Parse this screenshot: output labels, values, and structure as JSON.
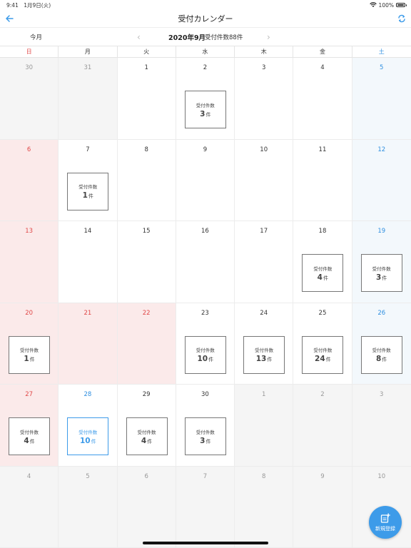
{
  "status_bar": {
    "time": "9:41",
    "date": "1月9日(火)",
    "battery": "100%",
    "battery_level": 1.0
  },
  "nav": {
    "title": "受付カレンダー"
  },
  "month_bar": {
    "today_label": "今月",
    "month": "2020年9月",
    "count_text": "受付件数88件"
  },
  "weekdays": [
    "日",
    "月",
    "火",
    "水",
    "木",
    "金",
    "土"
  ],
  "box_label": "受付件数",
  "unit": "件",
  "weeks": [
    [
      {
        "day": "30",
        "kind": "outside"
      },
      {
        "day": "31",
        "kind": "outside"
      },
      {
        "day": "1"
      },
      {
        "day": "2",
        "count": "3"
      },
      {
        "day": "3"
      },
      {
        "day": "4"
      },
      {
        "day": "5",
        "kind": "saturday"
      }
    ],
    [
      {
        "day": "6",
        "kind": "holiday"
      },
      {
        "day": "7",
        "count": "1"
      },
      {
        "day": "8"
      },
      {
        "day": "9"
      },
      {
        "day": "10"
      },
      {
        "day": "11"
      },
      {
        "day": "12",
        "kind": "saturday"
      }
    ],
    [
      {
        "day": "13",
        "kind": "holiday"
      },
      {
        "day": "14"
      },
      {
        "day": "15"
      },
      {
        "day": "16"
      },
      {
        "day": "17"
      },
      {
        "day": "18",
        "count": "4"
      },
      {
        "day": "19",
        "kind": "saturday",
        "count": "3"
      }
    ],
    [
      {
        "day": "20",
        "kind": "holiday",
        "count": "1"
      },
      {
        "day": "21",
        "kind": "holiday"
      },
      {
        "day": "22",
        "kind": "holiday"
      },
      {
        "day": "23",
        "count": "10"
      },
      {
        "day": "24",
        "count": "13"
      },
      {
        "day": "25",
        "count": "24"
      },
      {
        "day": "26",
        "kind": "saturday",
        "count": "8"
      }
    ],
    [
      {
        "day": "27",
        "kind": "holiday",
        "count": "4"
      },
      {
        "day": "28",
        "kind": "today",
        "count": "10"
      },
      {
        "day": "29",
        "count": "4"
      },
      {
        "day": "30",
        "count": "3"
      },
      {
        "day": "1",
        "kind": "outside"
      },
      {
        "day": "2",
        "kind": "outside"
      },
      {
        "day": "3",
        "kind": "outside"
      }
    ],
    [
      {
        "day": "4",
        "kind": "outside"
      },
      {
        "day": "5",
        "kind": "outside"
      },
      {
        "day": "6",
        "kind": "outside"
      },
      {
        "day": "7",
        "kind": "outside"
      },
      {
        "day": "8",
        "kind": "outside"
      },
      {
        "day": "9",
        "kind": "outside"
      },
      {
        "day": "10",
        "kind": "outside"
      }
    ]
  ],
  "fab": {
    "label": "新規登録",
    "icon": "add-document-icon"
  },
  "colors": {
    "accent": "#3d9be9",
    "holiday_bg": "#fbeaea",
    "saturday_text": "#2f8fe0",
    "sunday_text": "#e04848"
  }
}
